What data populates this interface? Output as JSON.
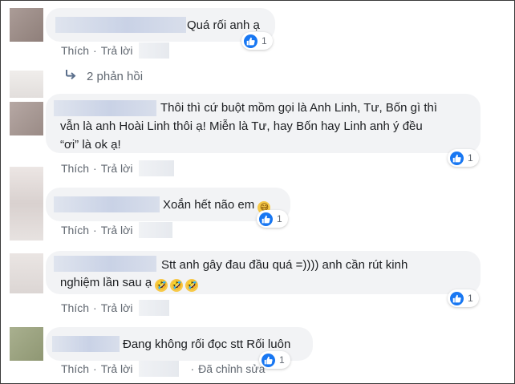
{
  "colors": {
    "bubble": "#f2f3f5",
    "like_blue": "#1877f2",
    "meta_text": "#606770"
  },
  "actions": {
    "like": "Thích",
    "reply": "Trả lời",
    "dot": "·",
    "edited": "Đã chỉnh sửa"
  },
  "replies_link": {
    "icon": "reply-arrow-icon",
    "label": "2 phản hồi"
  },
  "comments": [
    {
      "lines": [
        "Quá rối anh ạ"
      ],
      "reactions": "1"
    },
    {
      "lines": [
        "Thôi thì cứ buột mồm gọi là Anh Linh, Tư, Bốn gì thì",
        "vẫn là anh Hoài Linh thôi ạ! Miễn là Tư, hay Bốn hay Linh anh ý đều",
        "“ơi” là ok ạ!"
      ],
      "reactions": "1"
    },
    {
      "lines": [
        "Xoắn hết não em"
      ],
      "emoji": "grinning-sweat-emoji",
      "reactions": "1"
    },
    {
      "lines": [
        "Stt anh gây đau đầu quá =)))) anh cần rút kinh",
        "nghiệm lần sau ạ"
      ],
      "emoji": "rofl-emoji",
      "reactions": "1"
    },
    {
      "lines": [
        "Đang không rối đọc stt Rối luôn"
      ],
      "reactions": "1"
    }
  ]
}
